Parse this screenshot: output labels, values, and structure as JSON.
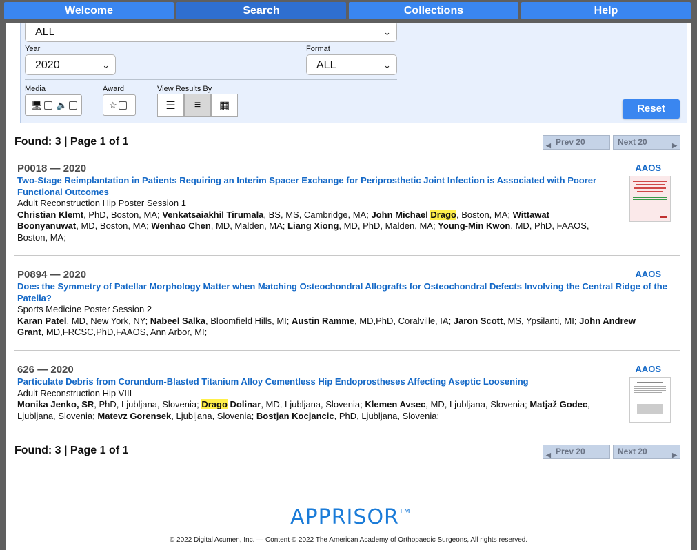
{
  "nav": {
    "tabs": [
      "Welcome",
      "Search",
      "Collections",
      "Help"
    ]
  },
  "search": {
    "top_select_value": "ALL",
    "year_label": "Year",
    "year_value": "2020",
    "format_label": "Format",
    "format_value": "ALL",
    "media_label": "Media",
    "award_label": "Award",
    "view_label": "View Results By",
    "reset_label": "Reset"
  },
  "summary": {
    "found_text": "Found: 3 | Page 1 of 1",
    "prev_label": "Prev 20",
    "next_label": "Next 20"
  },
  "results": [
    {
      "id": "P0018 — 2020",
      "title": "Two-Stage Reimplantation in Patients Requiring an Interim Spacer Exchange for Periprosthetic Joint Infection is Associated with Poorer Functional Outcomes",
      "session": "Adult Reconstruction Hip Poster Session 1",
      "source": "AAOS",
      "authors": [
        {
          "pre": "",
          "name": "Christian Klemt",
          "hl": "",
          "rest": ", PhD, Boston, MA; "
        },
        {
          "pre": "",
          "name": "Venkatsaiakhil Tirumala",
          "hl": "",
          "rest": ", BS, MS, Cambridge, MA; "
        },
        {
          "pre": "",
          "name": "John Michael ",
          "hl": "Drago",
          "rest": ", Boston, MA; "
        },
        {
          "pre": "",
          "name": "Wittawat Boonyanuwat",
          "hl": "",
          "rest": ", MD, Boston, MA; "
        },
        {
          "pre": "",
          "name": "Wenhao Chen",
          "hl": "",
          "rest": ", MD, Malden, MA; "
        },
        {
          "pre": "",
          "name": "Liang Xiong",
          "hl": "",
          "rest": ", MD, PhD, Malden, MA; "
        },
        {
          "pre": "",
          "name": "Young-Min Kwon",
          "hl": "",
          "rest": ", MD, PhD, FAAOS, Boston, MA;"
        }
      ]
    },
    {
      "id": "P0894 — 2020",
      "title": "Does the Symmetry of Patellar Morphology Matter when Matching Osteochondral Allografts for Osteochondral Defects Involving the Central Ridge of the Patella?",
      "session": "Sports Medicine Poster Session 2",
      "source": "AAOS",
      "authors": [
        {
          "pre": "",
          "name": "Karan Patel",
          "hl": "",
          "rest": ", MD, New York, NY; "
        },
        {
          "pre": "",
          "name": "Nabeel Salka",
          "hl": "",
          "rest": ", Bloomfield Hills, MI; "
        },
        {
          "pre": "",
          "name": "Austin Ramme",
          "hl": "",
          "rest": ", MD,PhD, Coralville, IA; "
        },
        {
          "pre": "",
          "name": "Jaron Scott",
          "hl": "",
          "rest": ", MS, Ypsilanti, MI; "
        },
        {
          "pre": "",
          "name": "John Andrew Grant",
          "hl": "",
          "rest": ", MD,FRCSC,PhD,FAAOS, Ann Arbor, MI;"
        }
      ]
    },
    {
      "id": "626 — 2020",
      "title": "Particulate Debris from Corundum-Blasted Titanium Alloy Cementless Hip Endoprostheses Affecting Aseptic Loosening",
      "session": "Adult Reconstruction Hip VIII",
      "source": "AAOS",
      "authors": [
        {
          "pre": "",
          "name": "Monika Jenko, SR",
          "hl": "",
          "rest": ", PhD, Ljubljana, Slovenia; "
        },
        {
          "pre": "",
          "name": "",
          "hl": "Drago",
          "rest": "",
          "name2": " Dolinar",
          "rest2": ", MD, Ljubljana, Slovenia; "
        },
        {
          "pre": "",
          "name": "Klemen Avsec",
          "hl": "",
          "rest": ", MD, Ljubljana, Slovenia; "
        },
        {
          "pre": "",
          "name": "Matjaž Godec",
          "hl": "",
          "rest": ", Ljubljana, Slovenia; "
        },
        {
          "pre": "",
          "name": "Matevz Gorensek",
          "hl": "",
          "rest": ", Ljubljana, Slovenia; "
        },
        {
          "pre": "",
          "name": "Bostjan Kocjancic",
          "hl": "",
          "rest": ", PhD, Ljubljana, Slovenia;"
        }
      ]
    }
  ],
  "footer": {
    "logo_text": "APPRISOR",
    "logo_tm": "TM",
    "copyright": "© 2022 Digital Acumen, Inc. — Content © 2022 The American Academy of Orthopaedic Surgeons, All rights reserved."
  },
  "colors": {
    "accent": "#3a86f0",
    "link": "#1569c7",
    "highlight": "#fff04a",
    "panel": "#e8f0fd"
  }
}
